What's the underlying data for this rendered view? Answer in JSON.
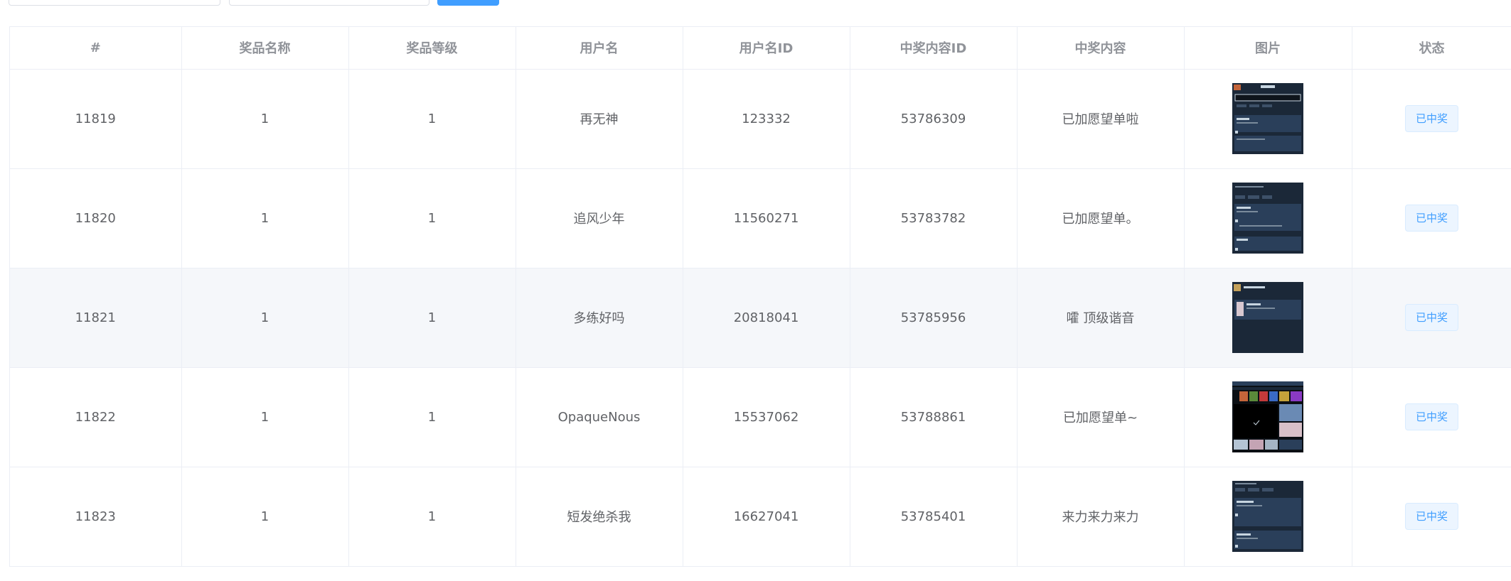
{
  "filters": {
    "search_button_label": ""
  },
  "table": {
    "columns": [
      "#",
      "奖品名称",
      "奖品等级",
      "用户名",
      "用户名ID",
      "中奖内容ID",
      "中奖内容",
      "图片",
      "状态"
    ],
    "rows": [
      {
        "id": "11819",
        "prize_name": "1",
        "prize_level": "1",
        "username": "再无神",
        "user_id": "123332",
        "content_id": "53786309",
        "content": "已加愿望单啦",
        "status": "已中奖"
      },
      {
        "id": "11820",
        "prize_name": "1",
        "prize_level": "1",
        "username": "追风少年",
        "user_id": "11560271",
        "content_id": "53783782",
        "content": "已加愿望单。",
        "status": "已中奖"
      },
      {
        "id": "11821",
        "prize_name": "1",
        "prize_level": "1",
        "username": "多练好吗",
        "user_id": "20818041",
        "content_id": "53785956",
        "content": "嚯 顶级谐音",
        "status": "已中奖"
      },
      {
        "id": "11822",
        "prize_name": "1",
        "prize_level": "1",
        "username": "OpaqueNous",
        "user_id": "15537062",
        "content_id": "53788861",
        "content": "已加愿望单~",
        "status": "已中奖"
      },
      {
        "id": "11823",
        "prize_name": "1",
        "prize_level": "1",
        "username": "短发绝杀我",
        "user_id": "16627041",
        "content_id": "53785401",
        "content": "来力来力来力",
        "status": "已中奖"
      }
    ]
  },
  "colors": {
    "primary": "#409eff",
    "header_text": "#909399",
    "cell_text": "#606266",
    "border": "#ebeef5",
    "hover_row": "#f5f7fa",
    "thumbnail_bg": "#1b2838"
  }
}
